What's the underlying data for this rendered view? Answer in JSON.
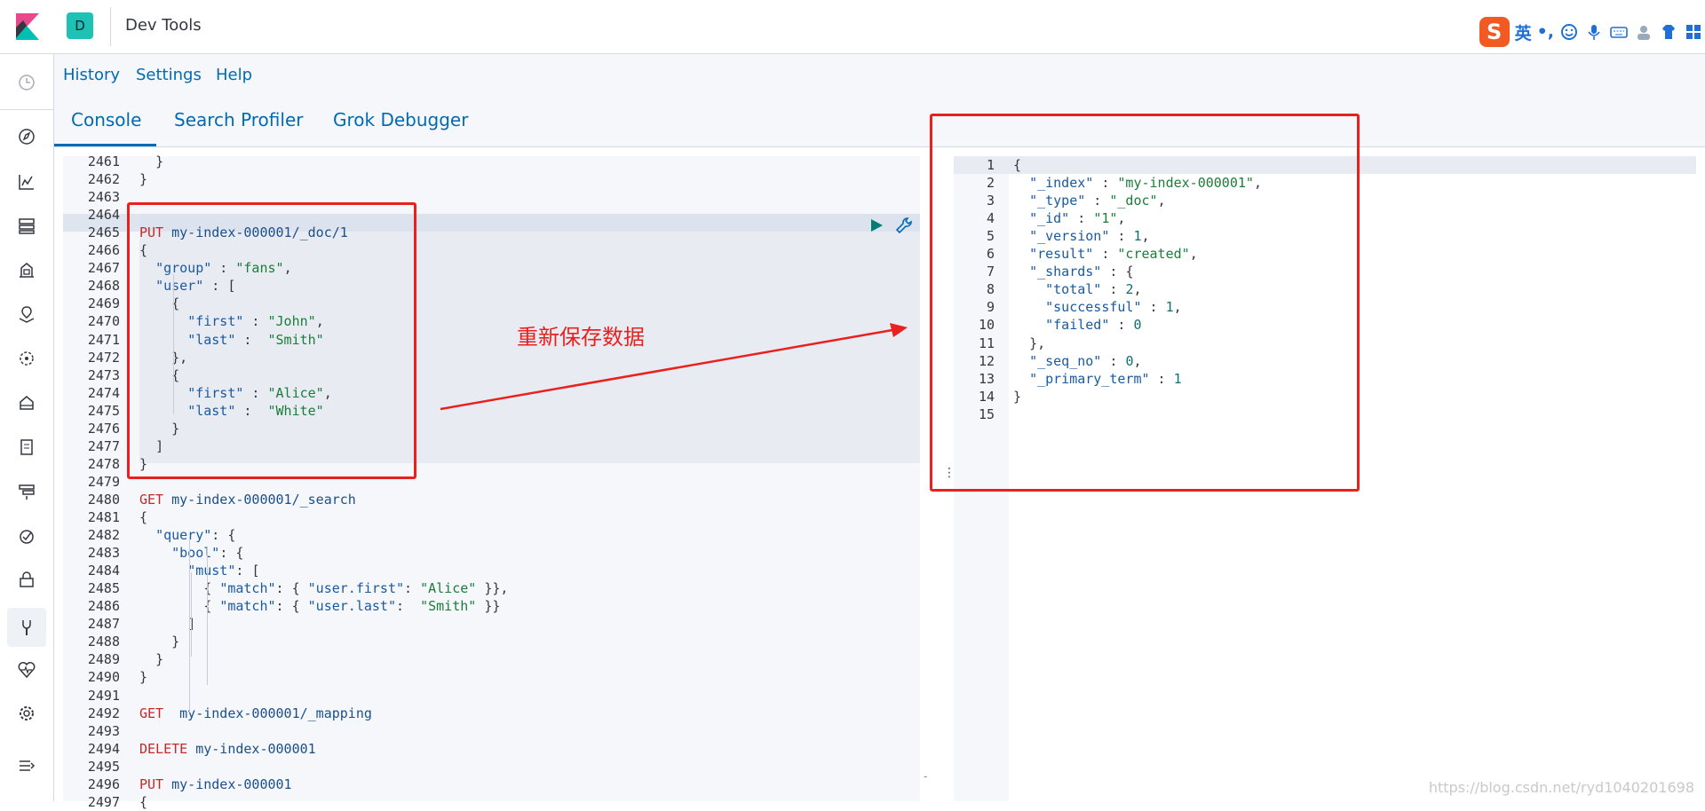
{
  "header": {
    "space_letter": "D",
    "app_title": "Dev Tools",
    "ime": {
      "logo": "S",
      "lang": "英",
      "punct": "•,"
    }
  },
  "menu": {
    "history": "History",
    "settings": "Settings",
    "help": "Help"
  },
  "tabs": [
    {
      "label": "Console",
      "active": true
    },
    {
      "label": "Search Profiler"
    },
    {
      "label": "Grok Debugger"
    }
  ],
  "left_nav": [
    "clock-icon",
    "compass-icon",
    "chart-icon",
    "dashboard-icon",
    "canvas-icon",
    "maps-icon",
    "ml-icon",
    "infra-icon",
    "logs-icon",
    "apm-icon",
    "uptime-icon",
    "siem-icon",
    "devtools-icon",
    "monitoring-icon",
    "management-icon",
    "collapse-icon"
  ],
  "editor": {
    "lines": [
      {
        "n": "2461",
        "t": "  }"
      },
      {
        "n": "2462",
        "t": "}"
      },
      {
        "n": "2463",
        "t": ""
      },
      {
        "n": "2464",
        "t": ""
      },
      {
        "n": "2465",
        "method": "PUT",
        "path": "my-index-000001/_doc/1"
      },
      {
        "n": "2466",
        "t": "{"
      },
      {
        "n": "2467",
        "t": "  \"group\" : \"fans\","
      },
      {
        "n": "2468",
        "t": "  \"user\" : ["
      },
      {
        "n": "2469",
        "t": "    {"
      },
      {
        "n": "2470",
        "t": "      \"first\" : \"John\","
      },
      {
        "n": "2471",
        "t": "      \"last\" :  \"Smith\""
      },
      {
        "n": "2472",
        "t": "    },"
      },
      {
        "n": "2473",
        "t": "    {"
      },
      {
        "n": "2474",
        "t": "      \"first\" : \"Alice\","
      },
      {
        "n": "2475",
        "t": "      \"last\" :  \"White\""
      },
      {
        "n": "2476",
        "t": "    }"
      },
      {
        "n": "2477",
        "t": "  ]"
      },
      {
        "n": "2478",
        "t": "}"
      },
      {
        "n": "2479",
        "t": ""
      },
      {
        "n": "2480",
        "method": "GET",
        "path": "my-index-000001/_search"
      },
      {
        "n": "2481",
        "t": "{"
      },
      {
        "n": "2482",
        "t": "  \"query\": {"
      },
      {
        "n": "2483",
        "t": "    \"bool\": {"
      },
      {
        "n": "2484",
        "t": "      \"must\": ["
      },
      {
        "n": "2485",
        "t": "        { \"match\": { \"user.first\": \"Alice\" }},"
      },
      {
        "n": "2486",
        "t": "        { \"match\": { \"user.last\":  \"Smith\" }}"
      },
      {
        "n": "2487",
        "t": "      ]"
      },
      {
        "n": "2488",
        "t": "    }"
      },
      {
        "n": "2489",
        "t": "  }"
      },
      {
        "n": "2490",
        "t": "}"
      },
      {
        "n": "2491",
        "t": ""
      },
      {
        "n": "2492",
        "method": "GET ",
        "path": "my-index-000001/_mapping"
      },
      {
        "n": "2493",
        "t": ""
      },
      {
        "n": "2494",
        "method": "DELETE",
        "path": "my-index-000001"
      },
      {
        "n": "2495",
        "t": ""
      },
      {
        "n": "2496",
        "method": "PUT",
        "path": "my-index-000001"
      },
      {
        "n": "2497",
        "t": "{"
      }
    ]
  },
  "output": {
    "lines": [
      {
        "n": "1",
        "t": "{"
      },
      {
        "n": "2",
        "t": "  \"_index\" : \"my-index-000001\","
      },
      {
        "n": "3",
        "t": "  \"_type\" : \"_doc\","
      },
      {
        "n": "4",
        "t": "  \"_id\" : \"1\","
      },
      {
        "n": "5",
        "t": "  \"_version\" : 1,"
      },
      {
        "n": "6",
        "t": "  \"result\" : \"created\","
      },
      {
        "n": "7",
        "t": "  \"_shards\" : {"
      },
      {
        "n": "8",
        "t": "    \"total\" : 2,"
      },
      {
        "n": "9",
        "t": "    \"successful\" : 1,"
      },
      {
        "n": "10",
        "t": "    \"failed\" : 0"
      },
      {
        "n": "11",
        "t": "  },"
      },
      {
        "n": "12",
        "t": "  \"_seq_no\" : 0,"
      },
      {
        "n": "13",
        "t": "  \"_primary_term\" : 1"
      },
      {
        "n": "14",
        "t": "}"
      },
      {
        "n": "15",
        "t": ""
      }
    ]
  },
  "annotation": {
    "text": "重新保存数据"
  },
  "watermark": "https://blog.csdn.net/ryd1040201698",
  "colors": {
    "accent": "#006bb4",
    "annotation": "#e8211f",
    "space_badge": "#1ec2b4"
  }
}
